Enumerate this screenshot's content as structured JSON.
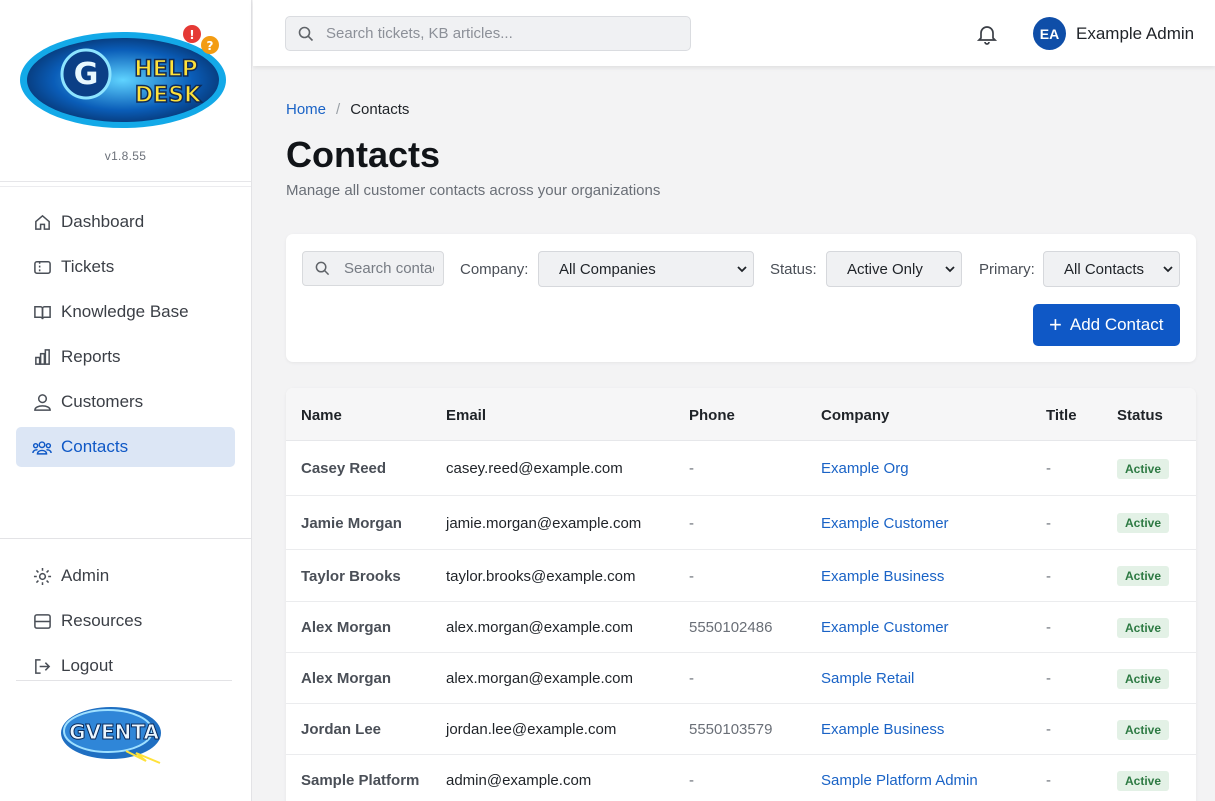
{
  "sidebar": {
    "logo_text": "HELP DESK",
    "logo_letter": "G",
    "version": "v1.8.55",
    "nav": [
      {
        "label": "Dashboard",
        "icon": "home-icon"
      },
      {
        "label": "Tickets",
        "icon": "ticket-icon"
      },
      {
        "label": "Knowledge Base",
        "icon": "book-icon"
      },
      {
        "label": "Reports",
        "icon": "bar-chart-icon"
      },
      {
        "label": "Customers",
        "icon": "user-icon"
      },
      {
        "label": "Contacts",
        "icon": "users-icon",
        "active": true
      }
    ],
    "bottom_nav": [
      {
        "label": "Admin",
        "icon": "gear-icon"
      },
      {
        "label": "Resources",
        "icon": "server-icon"
      },
      {
        "label": "Logout",
        "icon": "logout-icon"
      }
    ],
    "brand_text": "GVENTA"
  },
  "topbar": {
    "search_placeholder": "Search tickets, KB articles...",
    "avatar_initials": "EA",
    "user_name": "Example Admin"
  },
  "breadcrumb": {
    "home": "Home",
    "separator": "/",
    "current": "Contacts"
  },
  "page": {
    "title": "Contacts",
    "subtitle": "Manage all customer contacts across your organizations"
  },
  "filters": {
    "search_placeholder": "Search contacts...",
    "company_label": "Company:",
    "company_value": "All Companies",
    "status_label": "Status:",
    "status_value": "Active Only",
    "primary_label": "Primary:",
    "primary_value": "All Contacts",
    "add_button": "Add Contact"
  },
  "table": {
    "headers": [
      "Name",
      "Email",
      "Phone",
      "Company",
      "Title",
      "Status"
    ],
    "rows": [
      {
        "name": "Casey Reed",
        "email": "casey.reed@example.com",
        "phone": "-",
        "company": "Example Org",
        "title": "-",
        "status": "Active"
      },
      {
        "name": "Jamie Morgan",
        "email": "jamie.morgan@example.com",
        "phone": "-",
        "company": "Example Customer",
        "title": "-",
        "status": "Active"
      },
      {
        "name": "Taylor Brooks",
        "email": "taylor.brooks@example.com",
        "phone": "-",
        "company": "Example Business",
        "title": "-",
        "status": "Active"
      },
      {
        "name": "Alex Morgan",
        "email": "alex.morgan@example.com",
        "phone": "5550102486",
        "company": "Example Customer",
        "title": "-",
        "status": "Active"
      },
      {
        "name": "Alex Morgan",
        "email": "alex.morgan@example.com",
        "phone": "-",
        "company": "Sample Retail",
        "title": "-",
        "status": "Active"
      },
      {
        "name": "Jordan Lee",
        "email": "jordan.lee@example.com",
        "phone": "5550103579",
        "company": "Example Business",
        "title": "-",
        "status": "Active"
      },
      {
        "name": "Sample Platform",
        "email": "admin@example.com",
        "phone": "-",
        "company": "Sample Platform Admin",
        "title": "-",
        "status": "Active"
      }
    ]
  },
  "colors": {
    "accent": "#0f58c6",
    "active_nav_bg": "#dce6f5",
    "status_bg": "#e3f1e6",
    "status_text": "#2d7a43",
    "link": "#1a63c6"
  }
}
